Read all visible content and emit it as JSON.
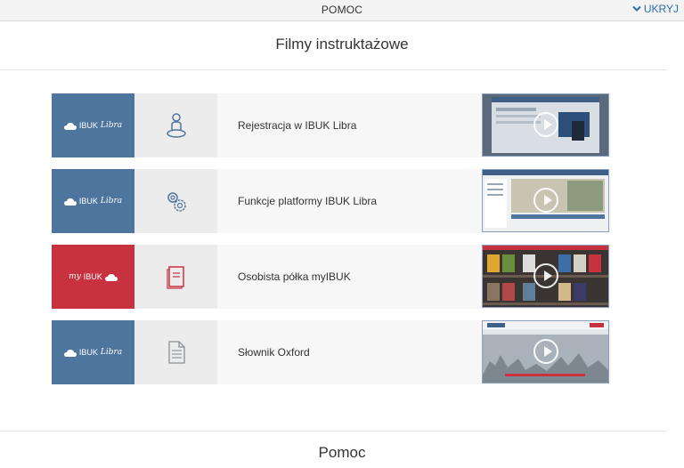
{
  "topbar": {
    "title": "POMOC",
    "hide_label": "UKRYJ"
  },
  "videos_section": {
    "title": "Filmy instruktażowe"
  },
  "videos": [
    {
      "brand": "IBUK",
      "brand_script": "Libra",
      "brand_color": "#4e759e",
      "icon": "user-icon",
      "label": "Rejestracja w IBUK Libra"
    },
    {
      "brand": "IBUK",
      "brand_script": "Libra",
      "brand_color": "#4e759e",
      "icon": "gears-icon",
      "label": "Funkcje platformy IBUK Libra"
    },
    {
      "brand": "IBUK",
      "brand_script": "my",
      "brand_color": "#c8323f",
      "icon": "book-icon",
      "label": "Osobista półka myIBUK"
    },
    {
      "brand": "IBUK",
      "brand_script": "Libra",
      "brand_color": "#4e759e",
      "icon": "document-icon",
      "label": "Słownik Oxford"
    }
  ],
  "help_section": {
    "title": "Pomoc"
  }
}
